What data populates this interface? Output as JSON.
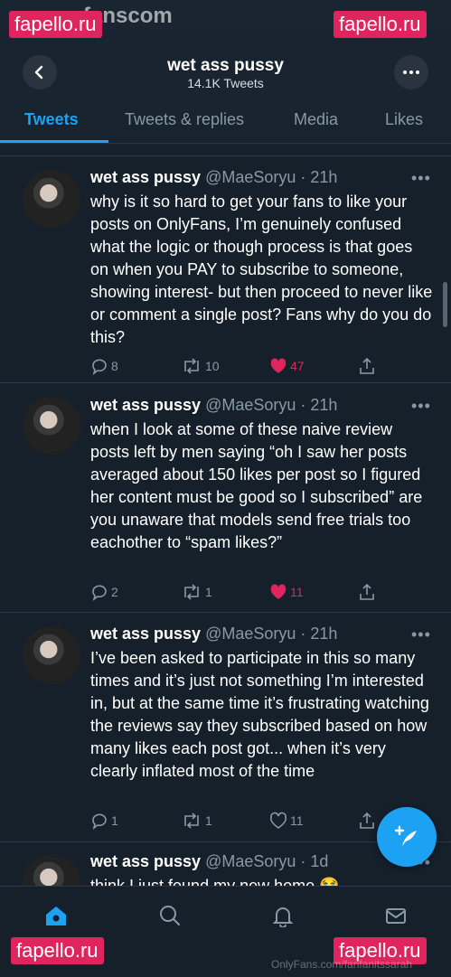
{
  "header": {
    "title": "wet ass pussy",
    "subtitle": "14.1K Tweets"
  },
  "tabs": [
    {
      "label": "Tweets",
      "active": true
    },
    {
      "label": "Tweets & replies",
      "active": false
    },
    {
      "label": "Media",
      "active": false
    },
    {
      "label": "Likes",
      "active": false
    }
  ],
  "watermark": {
    "label": "fapello.ru",
    "top_text": "fanscom",
    "bottom_text": "OnlyFans.com/fanfanitssarah"
  },
  "tweets": [
    {
      "name": "wet ass pussy",
      "handle": "@MaeSoryu · 21h",
      "more": "•••",
      "text": "why is it so hard to get your fans to like your posts on OnlyFans, I’m genuinely confused what the logic or though process is that goes on when you PAY to subscribe to someone, showing interest- but then proceed to never like or comment a single post? Fans why do you do this?",
      "replies": "8",
      "retweets": "10",
      "likes": "47",
      "liked": true
    },
    {
      "name": "wet ass pussy",
      "handle": "@MaeSoryu · 21h",
      "more": "•••",
      "text": "when I look at some of these naive review posts left by men saying “oh I saw her posts averaged about 150 likes per post so I figured her content must be good so I subscribed” are you unaware that models send free trials too eachother to “spam likes?”",
      "replies": "2",
      "retweets": "1",
      "likes": "11",
      "liked": true
    },
    {
      "name": "wet ass pussy",
      "handle": "@MaeSoryu · 21h",
      "more": "•••",
      "text": "I’ve been asked to participate in this so many times and it’s just not something I’m interested in, but at the same time it’s frustrating watching the reviews say they subscribed based on how many likes each post got... when it’s very clearly inflated most of the time",
      "replies": "1",
      "retweets": "1",
      "likes": "11",
      "liked": false
    },
    {
      "name": "wet ass pussy",
      "handle": "@MaeSoryu · 1d",
      "more": "•••",
      "text": "think I just found my new home 😭"
    }
  ],
  "colors": {
    "background": "#15202b",
    "accent": "#1da1f2",
    "like": "#e0245e",
    "secondary_text": "#8899a6"
  }
}
